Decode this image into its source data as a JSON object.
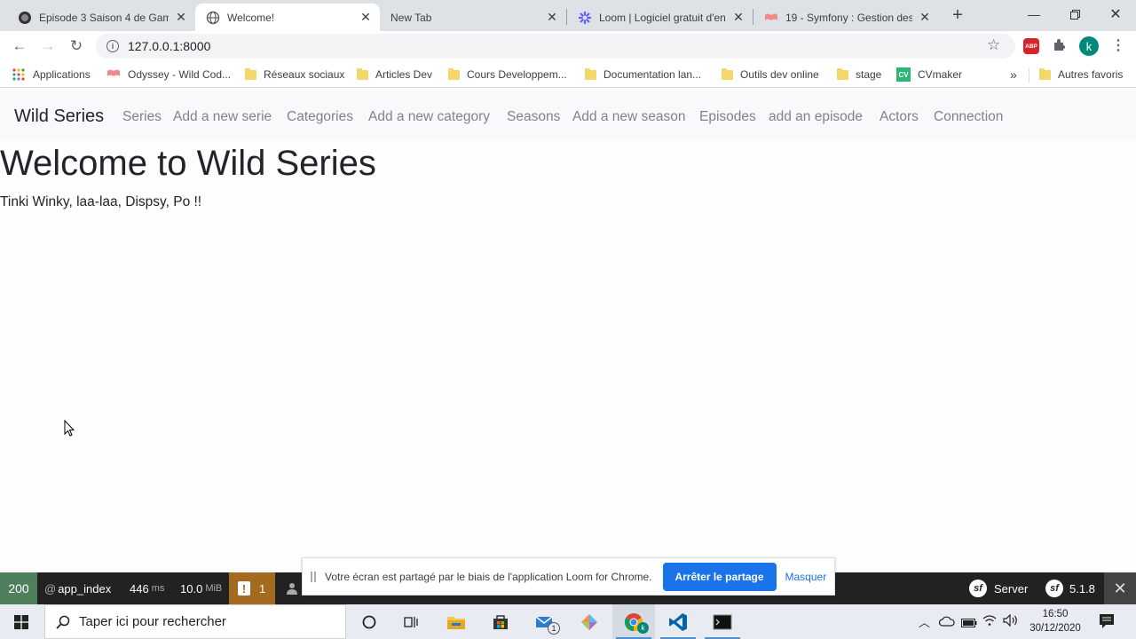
{
  "browser": {
    "tabs": [
      {
        "title": "Episode 3 Saison 4 de Gam",
        "icon": "game-of-thrones-favicon"
      },
      {
        "title": "Welcome!",
        "icon": "globe-icon"
      },
      {
        "title": "New Tab",
        "icon": ""
      },
      {
        "title": "Loom | Logiciel gratuit d'en",
        "icon": "loom-icon"
      },
      {
        "title": "19 - Symfony : Gestion des",
        "icon": "wild-code-icon"
      }
    ],
    "url": "127.0.0.1:8000",
    "bookmarks": [
      "Applications",
      "Odyssey - Wild Cod...",
      "Réseaux sociaux",
      "Articles Dev",
      "Cours Developpem...",
      "Documentation lan...",
      "Outils dev online",
      "stage",
      "CVmaker"
    ],
    "other_bookmarks": "Autres favoris",
    "cvmaker_badge": "CV",
    "abp_badge": "ABP",
    "profile_letter": "k"
  },
  "site": {
    "brand": "Wild Series",
    "nav": [
      "Series",
      "Add a new serie",
      "Categories",
      "Add a new category",
      "Seasons",
      "Add a new season",
      "Episodes",
      "add an episode",
      "Actors",
      "Connection"
    ],
    "title": "Welcome to Wild Series",
    "text": "Tinki Winky, laa-laa, Dispsy, Po !!"
  },
  "sf_toolbar": {
    "status": "200",
    "route": "app_index",
    "time_value": "446",
    "time_unit": "ms",
    "memory_value": "10.0",
    "memory_unit": "MiB",
    "warnings": "1",
    "server": "Server",
    "version": "5.1.8"
  },
  "loom_banner": {
    "message": "Votre écran est partagé par le biais de l'application Loom for Chrome.",
    "stop_label": "Arrêter le partage",
    "hide_label": "Masquer"
  },
  "taskbar": {
    "search_placeholder": "Taper ici pour rechercher",
    "time": "16:50",
    "date": "30/12/2020",
    "mail_badge": "1"
  },
  "colors": {
    "sf_status_green": "#4f805d",
    "sf_warning_orange": "#a46a1f",
    "loom_blue": "#1a73e8",
    "navbar_bg": "#f8f9fa"
  }
}
